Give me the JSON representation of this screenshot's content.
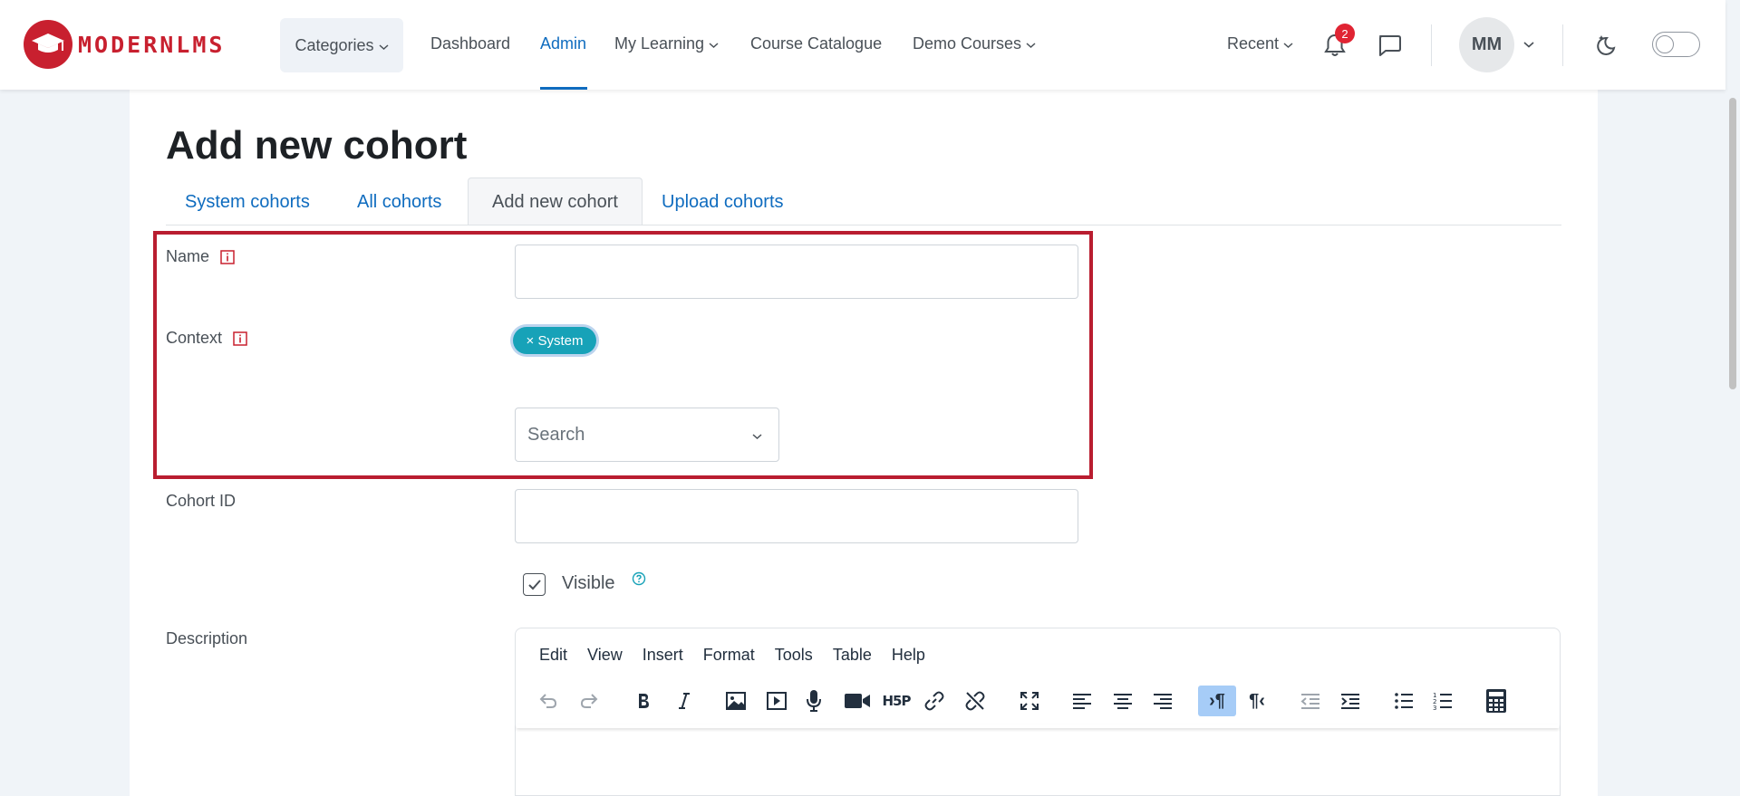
{
  "brand": {
    "name": "MODERNLMS"
  },
  "nav": {
    "categories": "Categories",
    "dashboard": "Dashboard",
    "admin": "Admin",
    "my_learning": "My Learning",
    "course_catalogue": "Course Catalogue",
    "demo_courses": "Demo Courses",
    "recent": "Recent",
    "notification_count": "2",
    "avatar_initials": "MM"
  },
  "page": {
    "title": "Add new cohort",
    "tabs": [
      "System cohorts",
      "All cohorts",
      "Add new cohort",
      "Upload cohorts"
    ],
    "active_tab": "Add new cohort"
  },
  "form": {
    "name_label": "Name",
    "name_value": "",
    "context_label": "Context",
    "context_chip": "× System",
    "search_placeholder": "Search",
    "cohort_id_label": "Cohort ID",
    "cohort_id_value": "",
    "visible_label": "Visible",
    "visible_checked": true,
    "description_label": "Description"
  },
  "editor": {
    "menu": [
      "Edit",
      "View",
      "Insert",
      "Format",
      "Tools",
      "Table",
      "Help"
    ]
  },
  "colors": {
    "brand": "#c8202f",
    "link": "#0f6cbf",
    "highlight": "#b91d30",
    "chip": "#17a2b8"
  }
}
